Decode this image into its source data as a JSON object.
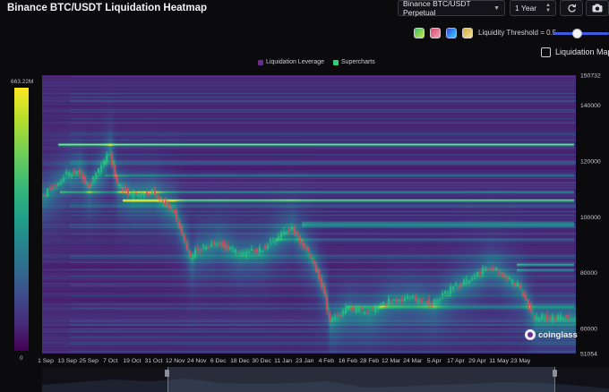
{
  "header": {
    "title": "Binance BTC/USDT Liquidation Heatmap",
    "pair_select": "Binance BTC/USDT Perpetual",
    "range_select": "1 Year"
  },
  "controls": {
    "threshold_label": "Liquidity Threshold = 0.5",
    "threshold_value": 0.5,
    "liquidation_map_label": "Liquidation Map",
    "liquidation_map_checked": false,
    "palette_swatches": [
      "green-yellow",
      "red-pink",
      "blue-cyan",
      "gold"
    ],
    "selected_palette": "blue-cyan"
  },
  "legend": {
    "items": [
      {
        "label": "Liquidation Leverage",
        "color": "#6a2a8f"
      },
      {
        "label": "Supercharts",
        "color": "#2fd07a"
      }
    ]
  },
  "colorbar": {
    "max_label": "663.22M",
    "min_label": "0"
  },
  "watermark": {
    "text": "coinglass"
  },
  "chart_data": {
    "type": "heatmap",
    "x_ticks": [
      "1 Sep",
      "13 Sep",
      "25 Sep",
      "7 Oct",
      "19 Oct",
      "31 Oct",
      "12 Nov",
      "24 Nov",
      "6 Dec",
      "18 Dec",
      "30 Dec",
      "11 Jan",
      "23 Jan",
      "4 Feb",
      "16 Feb",
      "28 Feb",
      "12 Mar",
      "24 Mar",
      "5 Apr",
      "17 Apr",
      "29 Apr",
      "11 May",
      "23 May"
    ],
    "y_top_label": "150732",
    "y_bottom_label": "51054",
    "y_ticks": [
      140000,
      120000,
      100000,
      80000,
      60000
    ],
    "ylim": [
      51054,
      150732
    ],
    "price_series": [
      {
        "date": "1 Sep",
        "price": 108000
      },
      {
        "date": "13 Sep",
        "price": 115000
      },
      {
        "date": "20 Sep",
        "price": 117000
      },
      {
        "date": "25 Sep",
        "price": 111000
      },
      {
        "date": "1 Oct",
        "price": 116000
      },
      {
        "date": "7 Oct",
        "price": 124000
      },
      {
        "date": "11 Oct",
        "price": 112000
      },
      {
        "date": "19 Oct",
        "price": 108000
      },
      {
        "date": "31 Oct",
        "price": 109000
      },
      {
        "date": "12 Nov",
        "price": 102000
      },
      {
        "date": "21 Nov",
        "price": 85000
      },
      {
        "date": "24 Nov",
        "price": 88000
      },
      {
        "date": "6 Dec",
        "price": 91000
      },
      {
        "date": "18 Dec",
        "price": 87000
      },
      {
        "date": "30 Dec",
        "price": 88000
      },
      {
        "date": "11 Jan",
        "price": 94000
      },
      {
        "date": "16 Jan",
        "price": 96000
      },
      {
        "date": "23 Jan",
        "price": 90000
      },
      {
        "date": "29 Jan",
        "price": 83000
      },
      {
        "date": "4 Feb",
        "price": 72000
      },
      {
        "date": "6 Feb",
        "price": 63000
      },
      {
        "date": "16 Feb",
        "price": 67000
      },
      {
        "date": "28 Feb",
        "price": 66000
      },
      {
        "date": "12 Mar",
        "price": 70000
      },
      {
        "date": "24 Mar",
        "price": 71000
      },
      {
        "date": "5 Apr",
        "price": 69000
      },
      {
        "date": "17 Apr",
        "price": 75000
      },
      {
        "date": "29 Apr",
        "price": 79000
      },
      {
        "date": "5 May",
        "price": 82000
      },
      {
        "date": "11 May",
        "price": 81000
      },
      {
        "date": "23 May",
        "price": 75000
      },
      {
        "date": "31 May",
        "price": 64000
      }
    ],
    "liquidity_bands": [
      {
        "price": 126000,
        "intensity": 1.0
      },
      {
        "price": 106000,
        "intensity": 0.9
      },
      {
        "price": 109000,
        "intensity": 0.6
      },
      {
        "price": 98000,
        "intensity": 0.55
      },
      {
        "price": 97000,
        "intensity": 0.45
      },
      {
        "price": 83000,
        "intensity": 0.8
      },
      {
        "price": 81000,
        "intensity": 0.5
      },
      {
        "price": 68000,
        "intensity": 0.4
      },
      {
        "price": 115000,
        "intensity": 0.35
      },
      {
        "price": 92000,
        "intensity": 0.3
      }
    ]
  }
}
